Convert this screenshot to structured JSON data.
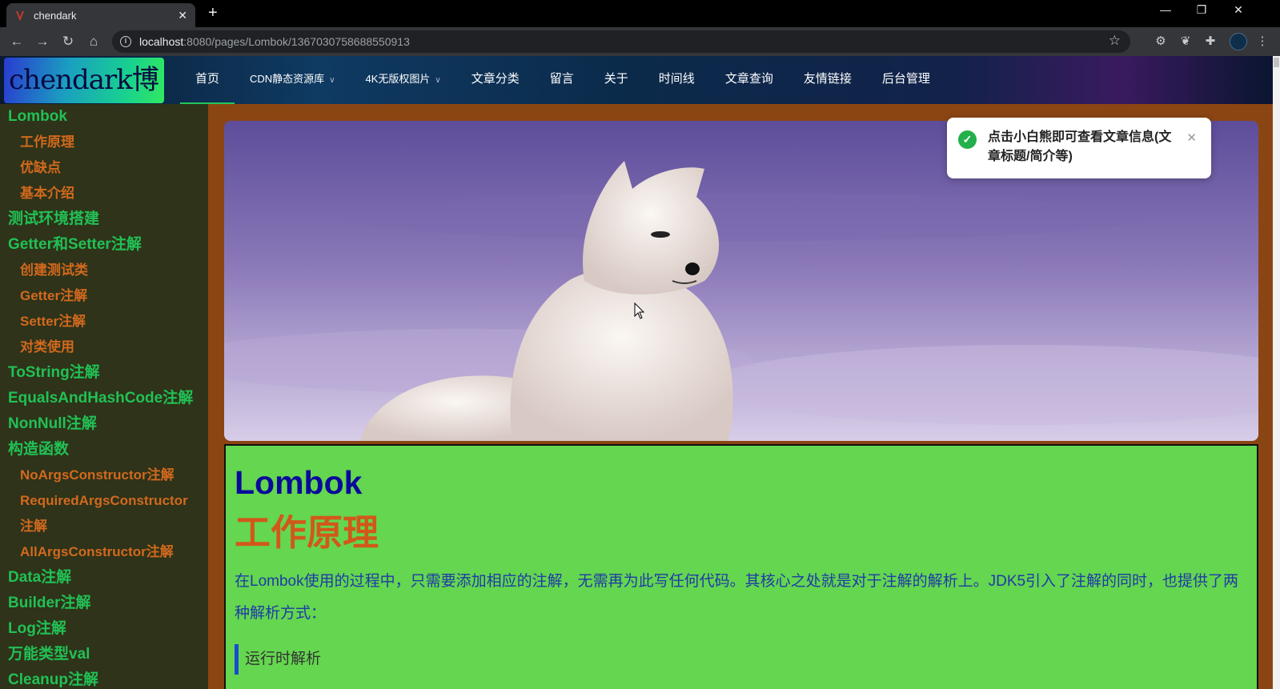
{
  "browser": {
    "tab_title": "chendark",
    "url_host": "localhost",
    "url_path": ":8080/pages/Lombok/1367030758688550913",
    "icons": [
      "back-icon",
      "forward-icon",
      "reload-icon",
      "home-icon",
      "star-icon",
      "extension-icon"
    ]
  },
  "site": {
    "logo_text": "chendark博客",
    "nav": [
      {
        "label": "首页"
      },
      {
        "label": "CDN静态资源库"
      },
      {
        "label": "4K无版权图片"
      },
      {
        "label": "文章分类"
      },
      {
        "label": "留言"
      },
      {
        "label": "关于"
      },
      {
        "label": "时间线"
      },
      {
        "label": "文章查询"
      },
      {
        "label": "友情链接"
      },
      {
        "label": "后台管理"
      }
    ]
  },
  "toc": [
    {
      "label": "Lombok",
      "level": 1
    },
    {
      "label": "工作原理",
      "level": 2
    },
    {
      "label": "优缺点",
      "level": 2
    },
    {
      "label": "基本介绍",
      "level": 2
    },
    {
      "label": "测试环境搭建",
      "level": 1
    },
    {
      "label": "Getter和Setter注解",
      "level": 1
    },
    {
      "label": "创建测试类",
      "level": 2
    },
    {
      "label": "Getter注解",
      "level": 2
    },
    {
      "label": "Setter注解",
      "level": 2
    },
    {
      "label": "对类使用",
      "level": 2
    },
    {
      "label": "ToString注解",
      "level": 1
    },
    {
      "label": "EqualsAndHashCode注解",
      "level": 1
    },
    {
      "label": "NonNull注解",
      "level": 1
    },
    {
      "label": "构造函数",
      "level": 1
    },
    {
      "label": "NoArgsConstructor注解",
      "level": 2
    },
    {
      "label": "RequiredArgsConstructor",
      "level": 2
    },
    {
      "label": "注解",
      "level": 2
    },
    {
      "label": "AllArgsConstructor注解",
      "level": 2
    },
    {
      "label": "Data注解",
      "level": 1
    },
    {
      "label": "Builder注解",
      "level": 1
    },
    {
      "label": "Log注解",
      "level": 1
    },
    {
      "label": "万能类型val",
      "level": 1
    },
    {
      "label": "Cleanup注解",
      "level": 1
    }
  ],
  "article": {
    "h1": "Lombok",
    "h2": "工作原理",
    "paragraph": "在Lombok使用的过程中，只需要添加相应的注解，无需再为此写任何代码。其核心之处就是对于注解的解析上。JDK5引入了注解的同时，也提供了两种解析方式：",
    "quote": "运行时解析"
  },
  "toast": {
    "message": "点击小白熊即可查看文章信息(文章标题/简介等)"
  },
  "colors": {
    "sidebar_bg": "#2e3319",
    "toc_level1": "#22c055",
    "toc_level2": "#d2691e",
    "article_bg": "#64d64f",
    "page_bg": "#8b4513",
    "nav_active": "#22c55e"
  }
}
